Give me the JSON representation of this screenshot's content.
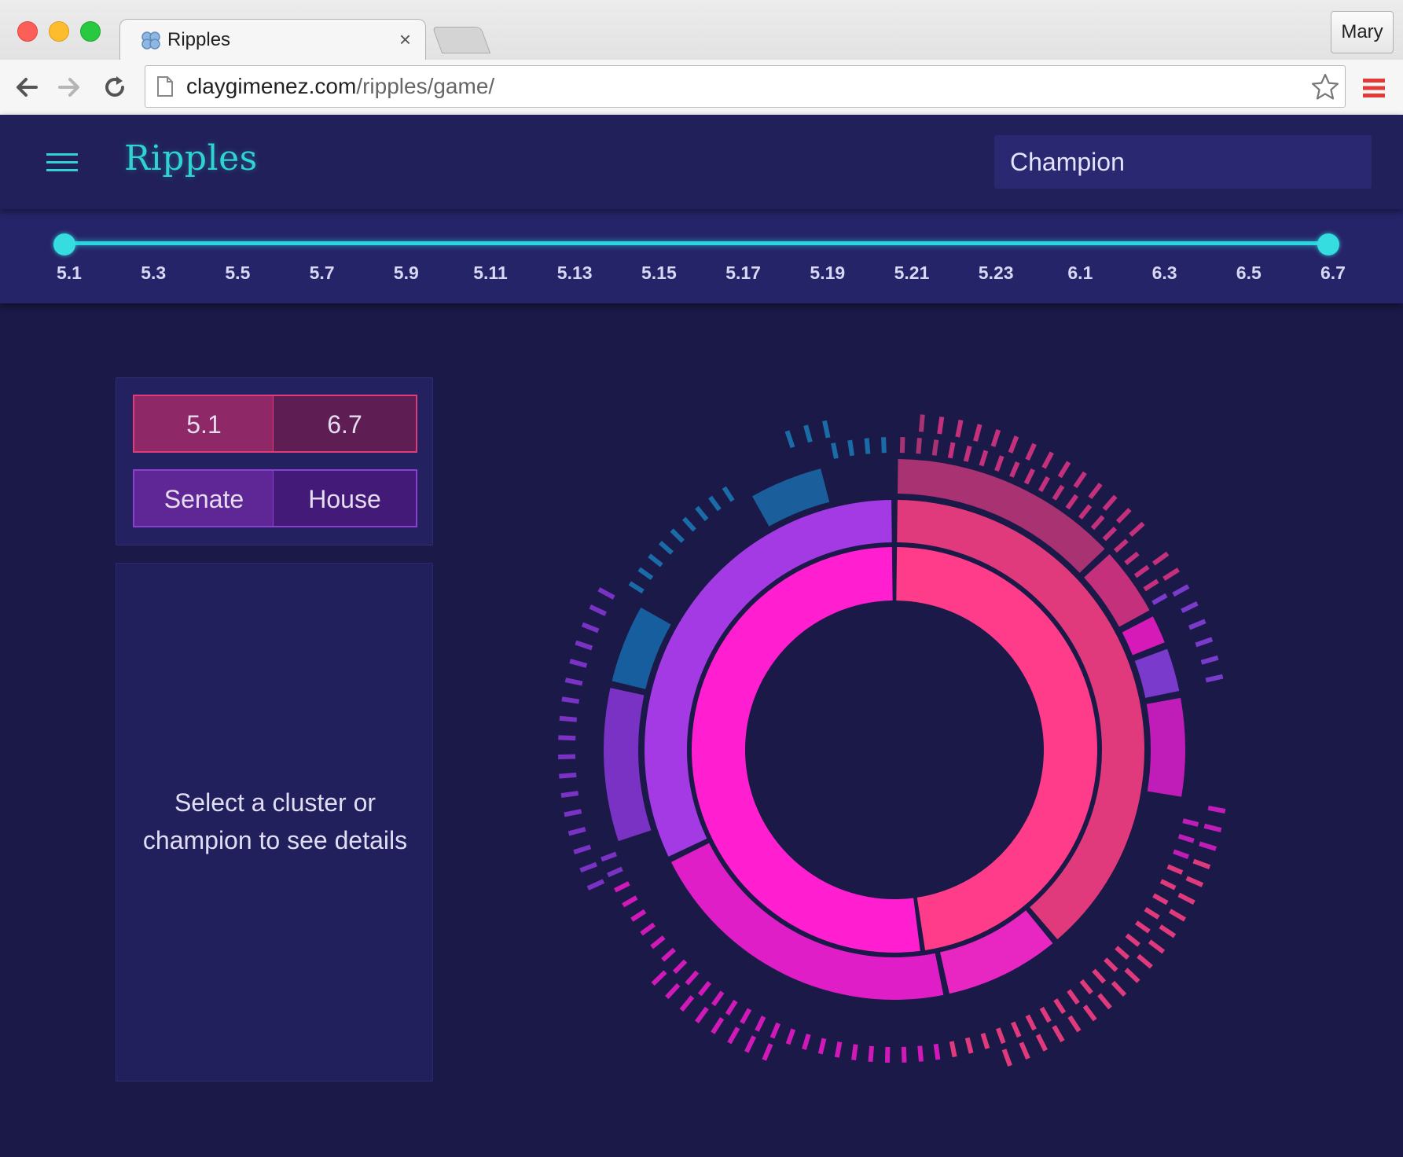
{
  "browser": {
    "tab_title": "Ripples",
    "tab_close": "×",
    "profile_name": "Mary",
    "url_host": "claygimenez.com",
    "url_path": "/ripples/game/"
  },
  "header": {
    "brand": "Ripples",
    "search_placeholder": "Champion"
  },
  "version_slider": {
    "ticks": [
      "5.1",
      "5.3",
      "5.5",
      "5.7",
      "5.9",
      "5.11",
      "5.13",
      "5.15",
      "5.17",
      "5.19",
      "5.21",
      "5.23",
      "6.1",
      "6.3",
      "6.5",
      "6.7"
    ],
    "range_start": "5.1",
    "range_end": "6.7"
  },
  "controls": {
    "version_from": "5.1",
    "version_to": "6.7",
    "senate_label": "Senate",
    "house_label": "House"
  },
  "details": {
    "line1": "Select a cluster or",
    "line2": "champion to see details"
  },
  "colors": {
    "background": "#1a1947",
    "accent_cyan": "#2fd3d0",
    "pink": "#ff3c8a",
    "magenta": "#ff1fd0",
    "purple": "#a43ae4",
    "blue": "#1270b0"
  },
  "chart_data": {
    "type": "sunburst",
    "rings": [
      {
        "level": 1,
        "segments": [
          {
            "start_deg": 0,
            "end_deg": 172,
            "color": "#ff3c8a"
          },
          {
            "start_deg": 172,
            "end_deg": 360,
            "color": "#ff1fd0"
          }
        ]
      },
      {
        "level": 2,
        "segments": [
          {
            "start_deg": 0,
            "end_deg": 140,
            "color": "#e03a7d"
          },
          {
            "start_deg": 140,
            "end_deg": 168,
            "color": "#e826c2"
          },
          {
            "start_deg": 168,
            "end_deg": 244,
            "color": "#e01ec8"
          },
          {
            "start_deg": 244,
            "end_deg": 360,
            "color": "#a43ae4"
          }
        ]
      },
      {
        "level": 3,
        "segments": [
          {
            "start_deg": 0,
            "end_deg": 47,
            "color": "#a83272"
          },
          {
            "start_deg": 47,
            "end_deg": 62,
            "color": "#c4307b"
          },
          {
            "start_deg": 62,
            "end_deg": 69,
            "color": "#d51ab8"
          },
          {
            "start_deg": 69,
            "end_deg": 79,
            "color": "#7a3acc"
          },
          {
            "start_deg": 79,
            "end_deg": 100,
            "color": "#c01cb8"
          },
          {
            "start_deg": 251,
            "end_deg": 283,
            "color": "#7a32c4"
          },
          {
            "start_deg": 283,
            "end_deg": 300,
            "color": "#175e9e"
          },
          {
            "start_deg": 330,
            "end_deg": 346,
            "color": "#1a5e9c"
          }
        ]
      }
    ]
  }
}
